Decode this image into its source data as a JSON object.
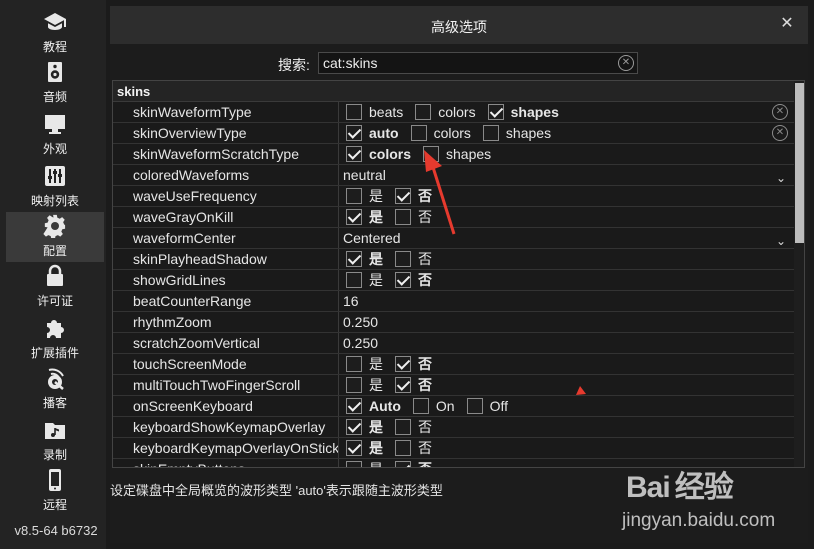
{
  "sidebar": {
    "items": [
      {
        "label": "教程",
        "icon": "graduation-cap-icon"
      },
      {
        "label": "音频",
        "icon": "speaker-icon"
      },
      {
        "label": "外观",
        "icon": "monitor-icon"
      },
      {
        "label": "映射列表",
        "icon": "mixer-icon"
      },
      {
        "label": "配置",
        "icon": "gear-icon",
        "active": true
      },
      {
        "label": "许可证",
        "icon": "lock-icon"
      },
      {
        "label": "扩展插件",
        "icon": "puzzle-icon"
      },
      {
        "label": "播客",
        "icon": "podcast-icon"
      },
      {
        "label": "录制",
        "icon": "music-folder-icon"
      },
      {
        "label": "远程",
        "icon": "phone-icon"
      }
    ],
    "version": "v8.5-64 b6732"
  },
  "dialog": {
    "title": "高级选项",
    "close_symbol": "✕",
    "search_label": "搜索:",
    "search_value": "cat:skins",
    "section": "skins",
    "rows": [
      {
        "key": "skinWaveformType",
        "options": [
          {
            "label": "beats",
            "checked": false
          },
          {
            "label": "colors",
            "checked": false
          },
          {
            "label": "shapes",
            "checked": true
          }
        ],
        "clear": true
      },
      {
        "key": "skinOverviewType",
        "options": [
          {
            "label": "auto",
            "checked": true
          },
          {
            "label": "colors",
            "checked": false
          },
          {
            "label": "shapes",
            "checked": false
          }
        ],
        "clear": true
      },
      {
        "key": "skinWaveformScratchType",
        "options": [
          {
            "label": "colors",
            "checked": true
          },
          {
            "label": "shapes",
            "checked": false
          }
        ]
      },
      {
        "key": "coloredWaveforms",
        "value": "neutral",
        "dropdown": true
      },
      {
        "key": "waveUseFrequency",
        "options": [
          {
            "label": "是",
            "checked": false
          },
          {
            "label": "否",
            "checked": true
          }
        ]
      },
      {
        "key": "waveGrayOnKill",
        "options": [
          {
            "label": "是",
            "checked": true
          },
          {
            "label": "否",
            "checked": false
          }
        ]
      },
      {
        "key": "waveformCenter",
        "value": "Centered",
        "dropdown": true
      },
      {
        "key": "skinPlayheadShadow",
        "options": [
          {
            "label": "是",
            "checked": true
          },
          {
            "label": "否",
            "checked": false
          }
        ]
      },
      {
        "key": "showGridLines",
        "options": [
          {
            "label": "是",
            "checked": false
          },
          {
            "label": "否",
            "checked": true
          }
        ]
      },
      {
        "key": "beatCounterRange",
        "value": "16"
      },
      {
        "key": "rhythmZoom",
        "value": "0.250"
      },
      {
        "key": "scratchZoomVertical",
        "value": "0.250"
      },
      {
        "key": "touchScreenMode",
        "options": [
          {
            "label": "是",
            "checked": false
          },
          {
            "label": "否",
            "checked": true
          }
        ]
      },
      {
        "key": "multiTouchTwoFingerScroll",
        "options": [
          {
            "label": "是",
            "checked": false
          },
          {
            "label": "否",
            "checked": true
          }
        ]
      },
      {
        "key": "onScreenKeyboard",
        "options": [
          {
            "label": "Auto",
            "checked": true
          },
          {
            "label": "On",
            "checked": false
          },
          {
            "label": "Off",
            "checked": false
          }
        ]
      },
      {
        "key": "keyboardShowKeymapOverlay",
        "options": [
          {
            "label": "是",
            "checked": true
          },
          {
            "label": "否",
            "checked": false
          }
        ]
      },
      {
        "key": "keyboardKeymapOverlayOnSticky",
        "options": [
          {
            "label": "是",
            "checked": true
          },
          {
            "label": "否",
            "checked": false
          }
        ]
      },
      {
        "key": "skinEmptyButtons",
        "options": [
          {
            "label": "是",
            "checked": false
          },
          {
            "label": "否",
            "checked": true
          }
        ]
      }
    ],
    "help_text": "设定碟盘中全局概览的波形类型 'auto'表示跟随主波形类型"
  },
  "watermark": {
    "brand": "Bai 经验",
    "url": "jingyan.baidu.com"
  },
  "colors": {
    "annotation_red": "#e63a2e",
    "background": "#1b1b1b",
    "titlebar": "#2d2d2d"
  }
}
